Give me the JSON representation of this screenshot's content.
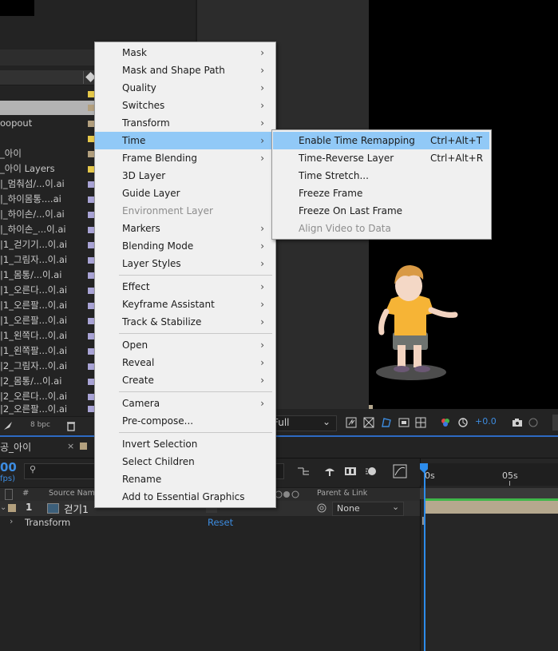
{
  "colors": {
    "menu_bg": "#f0f0f0",
    "menu_highlight": "#91c9f7",
    "accent_blue": "#2d8ceb",
    "label_yellow": "#e5c84a",
    "label_tan": "#b3a07e",
    "label_lavender": "#a9a4d6"
  },
  "project": {
    "files": [
      {
        "name": ""
      },
      {
        "name": ""
      },
      {
        "name": "oopout"
      },
      {
        "name": ""
      },
      {
        "name": "_아이"
      },
      {
        "name": "_아이 Layers"
      },
      {
        "name": "|_멈춰섬/...이.ai"
      },
      {
        "name": "|_하이몸통....ai"
      },
      {
        "name": "|_하이손/...이.ai"
      },
      {
        "name": "|_하이손_...이.ai"
      },
      {
        "name": "|1_걷기기...이.ai"
      },
      {
        "name": "|1_그림자...이.ai"
      },
      {
        "name": "|1_몸통/...이.ai"
      },
      {
        "name": "|1_오른다...이.ai"
      },
      {
        "name": "|1_오른팔...이.ai"
      },
      {
        "name": "|1_오른팔...이.ai"
      },
      {
        "name": "|1_왼쪽다...이.ai"
      },
      {
        "name": "|1_왼쪽팔...이.ai"
      },
      {
        "name": "|2_그림자...이.ai"
      },
      {
        "name": "|2_몸통/...이.ai"
      },
      {
        "name": "|2_오른다...이.ai"
      },
      {
        "name": "|2_오른팔...이.ai"
      }
    ],
    "bpc": "8 bpc"
  },
  "viewer": {
    "resolution": "Full",
    "exposure": "+0.0"
  },
  "timeline": {
    "tab_label": "공_아이",
    "timecode": "00",
    "fps": "fps)",
    "col_source_name": "Source Name",
    "col_parent": "Parent & Link",
    "layer_number": "1",
    "layer_name": "걷기1",
    "parent_value": "None",
    "transform_label": "Transform",
    "reset_label": "Reset",
    "ruler_start": "0s",
    "ruler_mark": "05s"
  },
  "menu": {
    "items": [
      {
        "label": "Mask",
        "submenu": true
      },
      {
        "label": "Mask and Shape Path",
        "submenu": true
      },
      {
        "label": "Quality",
        "submenu": true
      },
      {
        "label": "Switches",
        "submenu": true
      },
      {
        "label": "Transform",
        "submenu": true
      },
      {
        "label": "Time",
        "submenu": true
      },
      {
        "label": "Frame Blending",
        "submenu": true
      },
      {
        "label": "3D Layer",
        "submenu": false
      },
      {
        "label": "Guide Layer",
        "submenu": false
      },
      {
        "label": "Environment Layer",
        "submenu": false
      },
      {
        "label": "Markers",
        "submenu": true
      },
      {
        "label": "Blending Mode",
        "submenu": true
      },
      {
        "label": "Layer Styles",
        "submenu": true
      },
      {
        "label": "Effect",
        "submenu": true
      },
      {
        "label": "Keyframe Assistant",
        "submenu": true
      },
      {
        "label": "Track & Stabilize",
        "submenu": true
      },
      {
        "label": "Open",
        "submenu": true
      },
      {
        "label": "Reveal",
        "submenu": true
      },
      {
        "label": "Create",
        "submenu": true
      },
      {
        "label": "Camera",
        "submenu": true
      },
      {
        "label": "Pre-compose...",
        "submenu": false
      },
      {
        "label": "Invert Selection",
        "submenu": false
      },
      {
        "label": "Select Children",
        "submenu": false
      },
      {
        "label": "Rename",
        "submenu": false
      },
      {
        "label": "Add to Essential Graphics",
        "submenu": false
      }
    ],
    "arrow": "›"
  },
  "time_submenu": {
    "items": [
      {
        "label": "Enable Time Remapping",
        "shortcut": "Ctrl+Alt+T"
      },
      {
        "label": "Time-Reverse Layer",
        "shortcut": "Ctrl+Alt+R"
      },
      {
        "label": "Time Stretch...",
        "shortcut": ""
      },
      {
        "label": "Freeze Frame",
        "shortcut": ""
      },
      {
        "label": "Freeze On Last Frame",
        "shortcut": ""
      },
      {
        "label": "Align Video to Data",
        "shortcut": ""
      }
    ]
  }
}
